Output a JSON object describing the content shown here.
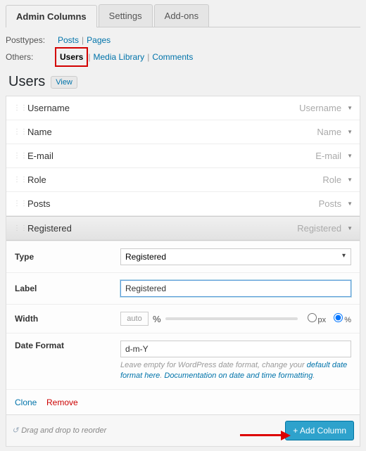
{
  "tabs": {
    "admin": "Admin Columns",
    "settings": "Settings",
    "addons": "Add-ons"
  },
  "filters": {
    "posttypes_label": "Posttypes:",
    "others_label": "Others:",
    "posts": "Posts",
    "pages": "Pages",
    "users": "Users",
    "media": "Media Library",
    "comments": "Comments",
    "sep": "|"
  },
  "heading": "Users",
  "view": "View",
  "columns": [
    {
      "label": "Username",
      "type": "Username"
    },
    {
      "label": "Name",
      "type": "Name"
    },
    {
      "label": "E-mail",
      "type": "E-mail"
    },
    {
      "label": "Role",
      "type": "Role"
    },
    {
      "label": "Posts",
      "type": "Posts"
    },
    {
      "label": "Registered",
      "type": "Registered"
    }
  ],
  "settings": {
    "type_label": "Type",
    "type_value": "Registered",
    "label_label": "Label",
    "label_value": "Registered",
    "width_label": "Width",
    "width_auto": "auto",
    "width_unit_pct": "%",
    "width_unit_px": "px",
    "dateformat_label": "Date Format",
    "dateformat_value": "d-m-Y",
    "helper_prefix": "Leave empty for WordPress date format, change your ",
    "helper_link1": "default date format here",
    "helper_mid": ". ",
    "helper_link2": "Documentation on date and time formatting",
    "helper_suffix": "."
  },
  "actions": {
    "clone": "Clone",
    "remove": "Remove"
  },
  "drag_hint": "Drag and drop to reorder",
  "add_column": "+ Add Column"
}
